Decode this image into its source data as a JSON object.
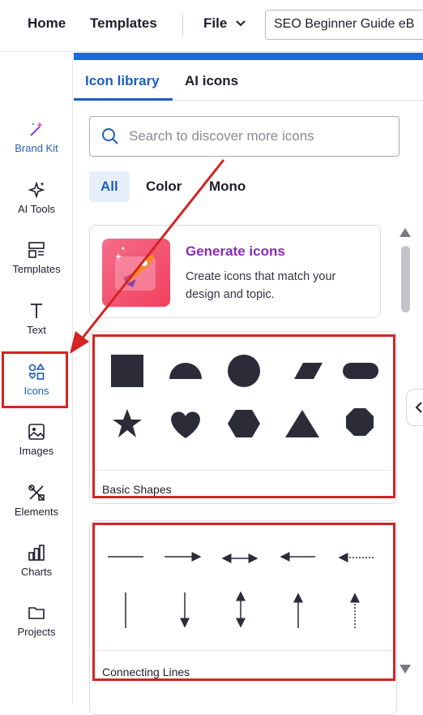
{
  "topbar": {
    "home_label": "Home",
    "templates_label": "Templates",
    "file_label": "File",
    "doc_title": "SEO Beginner Guide eB"
  },
  "sidebar": {
    "items": [
      {
        "label": "Brand Kit",
        "icon": "magic-wand-icon"
      },
      {
        "label": "AI Tools",
        "icon": "sparkles-icon"
      },
      {
        "label": "Templates",
        "icon": "templates-icon"
      },
      {
        "label": "Text",
        "icon": "text-icon"
      },
      {
        "label": "Icons",
        "icon": "shapes-icon",
        "active": true
      },
      {
        "label": "Images",
        "icon": "image-icon"
      },
      {
        "label": "Elements",
        "icon": "elements-icon"
      },
      {
        "label": "Charts",
        "icon": "chart-icon"
      },
      {
        "label": "Projects",
        "icon": "folder-icon"
      }
    ]
  },
  "panel": {
    "tabs": [
      {
        "label": "Icon library",
        "active": true
      },
      {
        "label": "AI icons"
      }
    ],
    "search": {
      "placeholder": "Search to discover more icons",
      "value": ""
    },
    "filters": [
      {
        "label": "All",
        "active": true
      },
      {
        "label": "Color"
      },
      {
        "label": "Mono"
      }
    ],
    "generate_card": {
      "title": "Generate icons",
      "description": "Create icons that match your design and topic."
    },
    "basic_shapes": {
      "label": "Basic Shapes",
      "shapes": [
        "square",
        "half-circle",
        "circle",
        "parallelogram",
        "pill",
        "star",
        "heart",
        "hexagon",
        "triangle",
        "octagon"
      ]
    },
    "connecting_lines": {
      "label": "Connecting Lines",
      "lines": [
        "line",
        "arrow-right",
        "double-arrow",
        "arrow-left",
        "dotted-arrow-left",
        "vertical-line",
        "arrow-down",
        "double-arrow-vertical",
        "arrow-up",
        "dotted-arrow-up"
      ]
    }
  },
  "colors": {
    "accent": "#1b5ec1",
    "highlight": "#d42424",
    "generate_title": "#8a2bb6"
  }
}
